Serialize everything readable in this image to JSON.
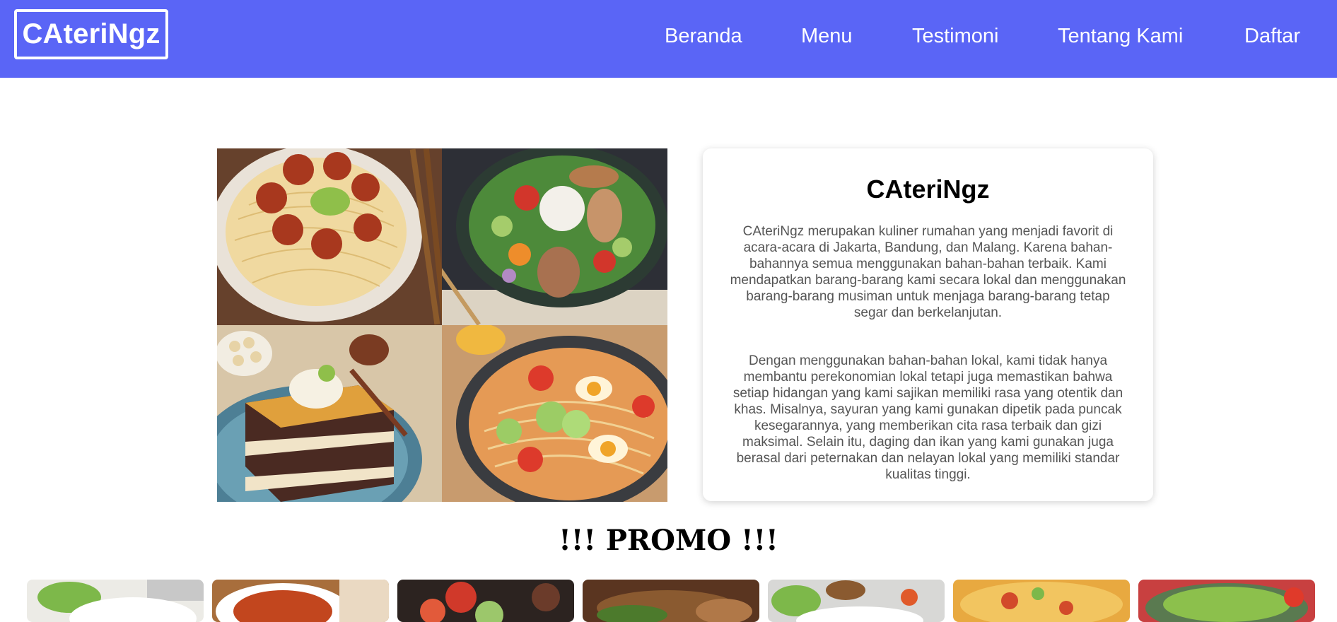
{
  "brand": {
    "name": "CAteriNgz"
  },
  "nav": {
    "items": [
      {
        "label": "Beranda"
      },
      {
        "label": "Menu"
      },
      {
        "label": "Testimoni"
      },
      {
        "label": "Tentang Kami"
      },
      {
        "label": "Daftar"
      }
    ]
  },
  "about": {
    "title": "CAteriNgz",
    "paragraph_1": "CAteriNgz merupakan kuliner rumahan yang menjadi favorit di acara-acara di Jakarta, Bandung, dan Malang. Karena bahan-bahannya semua menggunakan bahan-bahan terbaik. Kami mendapatkan barang-barang kami secara lokal dan menggunakan barang-barang musiman untuk menjaga barang-barang tetap segar dan berkelanjutan.",
    "paragraph_2": "Dengan menggunakan bahan-bahan lokal, kami tidak hanya membantu perekonomian lokal tetapi juga memastikan bahwa setiap hidangan yang kami sajikan memiliki rasa yang otentik dan khas. Misalnya, sayuran yang kami gunakan dipetik pada puncak kesegarannya, yang memberikan cita rasa terbaik dan gizi maksimal. Selain itu, daging dan ikan yang kami gunakan juga berasal dari peternakan dan nelayan lokal yang memiliki standar kualitas tinggi."
  },
  "promo": {
    "title": "!!! PROMO !!!",
    "card_count_visible": 7
  },
  "colors": {
    "navbar_bg": "#5a65f6",
    "nav_text": "#ffffff",
    "body_text": "#555555"
  }
}
